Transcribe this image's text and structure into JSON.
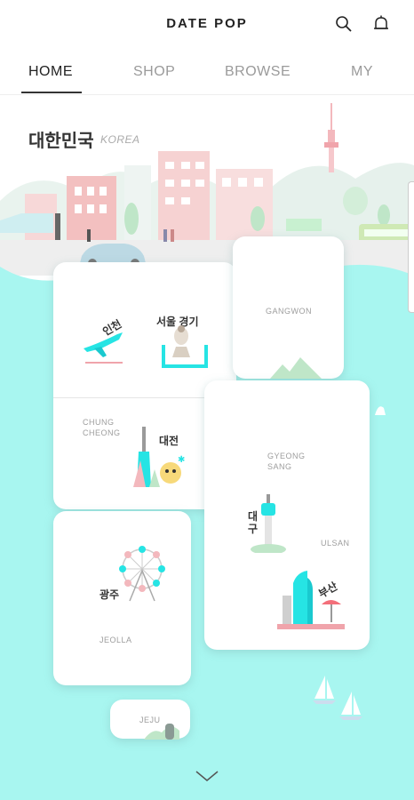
{
  "brand": "DATE POP",
  "header": {
    "search_icon": "search-icon",
    "bell_icon": "bell-icon"
  },
  "tabs": [
    {
      "label": "HOME",
      "active": true
    },
    {
      "label": "SHOP",
      "active": false
    },
    {
      "label": "BROWSE",
      "active": false
    },
    {
      "label": "MY",
      "active": false
    }
  ],
  "region": {
    "title": "대한민국",
    "subtitle": "KOREA"
  },
  "map": {
    "incheon": "인천",
    "seoul_gyeonggi": "서울 경기",
    "gangwon": "GANGWON",
    "chungcheong": "CHUNG\nCHEONG",
    "daejeon": "대전",
    "gyeongsang": "GYEONG\nSANG",
    "daegu": "대\n구",
    "ulsan": "ULSAN",
    "busan": "부산",
    "gwangju": "광주",
    "jeolla": "JEOLLA",
    "jeju": "JEJU"
  },
  "colors": {
    "sea": "#a8f6f0",
    "accent": "#26e4e4",
    "pink": "#f3b8bd",
    "green": "#bfe6c8"
  },
  "scroll_icon": "chevron-down-icon"
}
